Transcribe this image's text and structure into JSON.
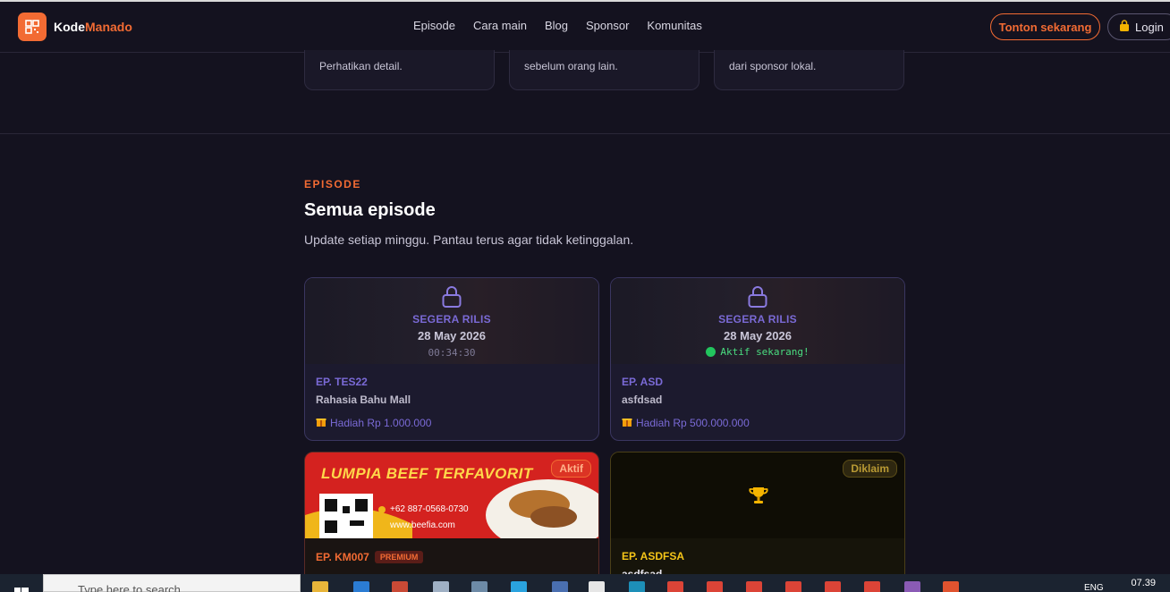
{
  "brand": {
    "name_a": "Kode",
    "name_b": "Manado"
  },
  "nav": [
    "Episode",
    "Cara main",
    "Blog",
    "Sponsor",
    "Komunitas"
  ],
  "header_buttons": {
    "watch": "Tonton sekarang",
    "login": "Login"
  },
  "features": [
    "Perhatikan detail.",
    "sebelum orang lain.",
    "dari sponsor lokal."
  ],
  "section": {
    "eyebrow": "EPISODE",
    "title": "Semua episode",
    "subtitle": "Update setiap minggu. Pantau terus agar tidak ketinggalan."
  },
  "cards": [
    {
      "status": "SEGERA RILIS",
      "date": "28 May 2026",
      "countdown": "00:34:30",
      "ep": "EP. TES22",
      "title": "Rahasia Bahu Mall",
      "prize": "Hadiah Rp 1.000.000"
    },
    {
      "status": "SEGERA RILIS",
      "date": "28 May 2026",
      "active": "Aktif sekarang!",
      "ep": "EP. ASD",
      "title": "asfdsad",
      "prize": "Hadiah Rp 500.000.000"
    },
    {
      "badge": "Aktif",
      "banner_title": "LUMPIA BEEF TERFAVORIT",
      "banner_phone": "+62 887-0568-0730",
      "banner_web": "www.beefia.com",
      "ep": "EP. KM007",
      "tag": "PREMIUM"
    },
    {
      "badge": "Diklaim",
      "ep": "EP. ASDFSA",
      "title": "asdfsad"
    }
  ],
  "taskbar": {
    "search_placeholder": "Type here to search",
    "lang": "ENG",
    "time": "07.39"
  },
  "colors": {
    "accent": "#f26b33",
    "purple": "#7a6ad6",
    "bg": "#14121f"
  }
}
